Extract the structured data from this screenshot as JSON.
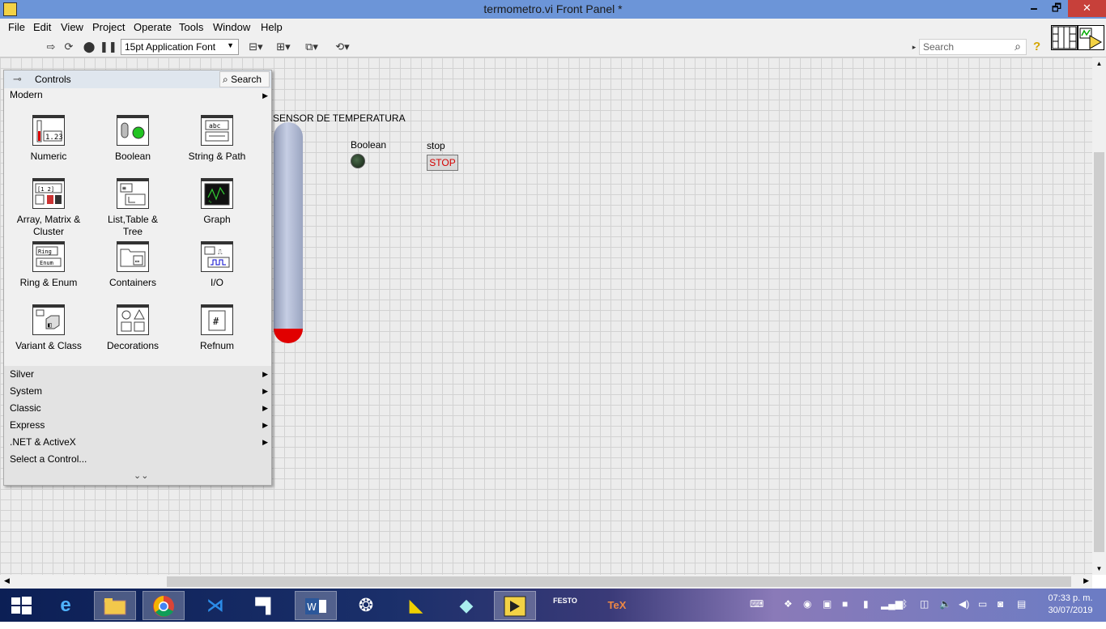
{
  "window": {
    "title": "termometro.vi Front Panel *",
    "minimize": "🗕",
    "maximize": "🗗",
    "close": "✕"
  },
  "menu": [
    "File",
    "Edit",
    "View",
    "Project",
    "Operate",
    "Tools",
    "Window",
    "Help"
  ],
  "toolbar": {
    "font": "15pt Application Font",
    "search_placeholder": "Search",
    "icons": [
      "run-arrow-icon",
      "run-continuously-icon",
      "abort-icon",
      "pause-icon",
      "align-icon",
      "distribute-icon",
      "resize-icon",
      "reorder-icon"
    ]
  },
  "front_panel": {
    "thermometer": {
      "label": "SENSOR DE TEMPERATURA"
    },
    "led": {
      "label": "Boolean"
    },
    "stop": {
      "label": "stop",
      "button_text": "STOP"
    }
  },
  "controls_palette": {
    "title": "Controls",
    "search": "Search",
    "category": "Modern",
    "tiles": [
      {
        "label": "Numeric",
        "glyph": "1.23"
      },
      {
        "label": "Boolean",
        "glyph": "●"
      },
      {
        "label": "String & Path",
        "glyph": "abc"
      },
      {
        "label": "Array, Matrix &\nCluster",
        "glyph": "[1 2]"
      },
      {
        "label": "List,Table &\nTree",
        "glyph": "≡"
      },
      {
        "label": "Graph",
        "glyph": "∿"
      },
      {
        "label": "Ring & Enum",
        "glyph": "Ring"
      },
      {
        "label": "Containers",
        "glyph": "▭"
      },
      {
        "label": "I/O",
        "glyph": "⎍"
      },
      {
        "label": "Variant & Class",
        "glyph": "◧"
      },
      {
        "label": "Decorations",
        "glyph": "○△"
      },
      {
        "label": "Refnum",
        "glyph": "#"
      }
    ],
    "submenus": [
      "Silver",
      "System",
      "Classic",
      "Express",
      ".NET & ActiveX"
    ],
    "select": "Select a Control..."
  },
  "taskbar": {
    "apps": [
      "windows-start-icon",
      "internet-explorer-icon",
      "file-explorer-icon",
      "chrome-icon",
      "visual-studio-code-icon",
      "notes-icon",
      "word-icon",
      "network-app-icon",
      "app-icon",
      "app-icon",
      "labview-icon",
      "festo-fluidsim-icon",
      "tex-icon"
    ],
    "clock_time": "07:33 p. m.",
    "clock_date": "30/07/2019"
  },
  "colors": {
    "title_bar": "#6c95d8",
    "close_button": "#c7403a",
    "thermo_fill": "#e10000",
    "stop_text": "#d40000"
  }
}
